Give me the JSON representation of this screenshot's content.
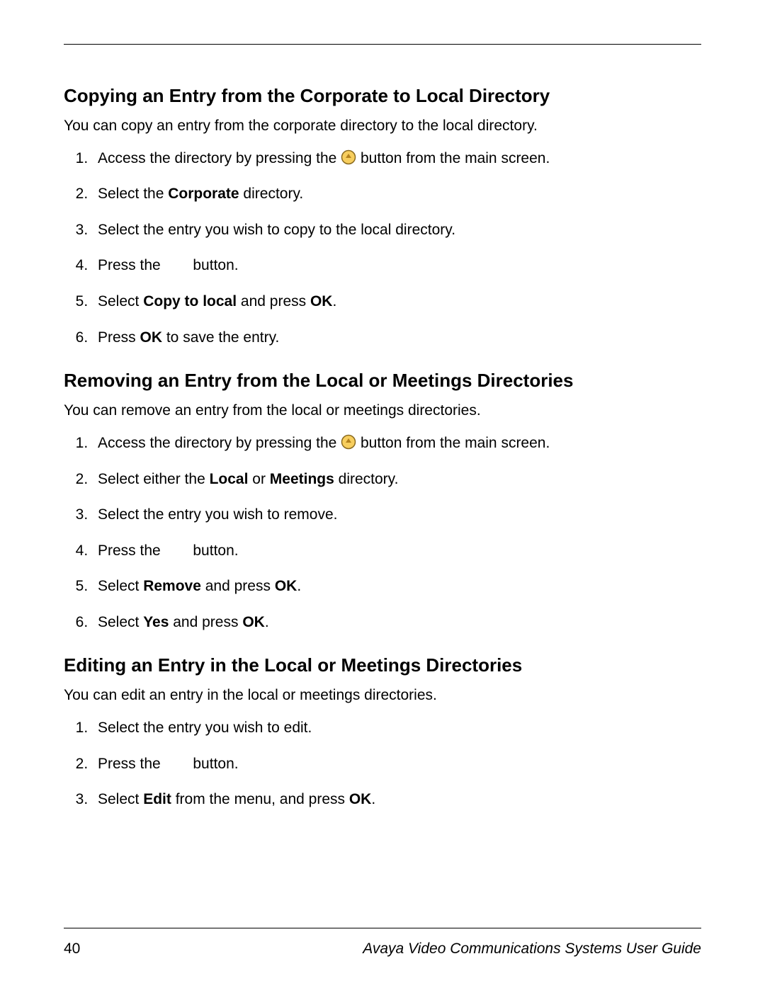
{
  "sections": [
    {
      "heading": "Copying an Entry from the Corporate to Local Directory",
      "intro": "You can copy an entry from the corporate directory to the local directory.",
      "steps": [
        {
          "pre": "Access the directory by pressing the ",
          "icon": "directory-icon",
          "post": " button from the main screen."
        },
        {
          "pre": "Select the ",
          "b1": "Corporate",
          "mid1": " directory."
        },
        {
          "pre": "Select the entry you wish to copy to the local directory."
        },
        {
          "pre": "Press the ",
          "gap": true,
          "mid1": " button."
        },
        {
          "pre": "Select ",
          "b1": "Copy to local",
          "mid1": " and press ",
          "b2": "OK",
          "mid2": "."
        },
        {
          "pre": "Press ",
          "b1": "OK",
          "mid1": " to save the entry."
        }
      ]
    },
    {
      "heading": "Removing an Entry from the Local or Meetings Directories",
      "intro": "You can remove an entry from the local or meetings directories.",
      "steps": [
        {
          "pre": "Access the directory by pressing the ",
          "icon": "directory-icon",
          "post": " button from the main screen."
        },
        {
          "pre": "Select either the ",
          "b1": "Local",
          "mid1": " or ",
          "b2": "Meetings",
          "mid2": " directory."
        },
        {
          "pre": "Select the entry you wish to remove."
        },
        {
          "pre": "Press the ",
          "gap": true,
          "mid1": " button."
        },
        {
          "pre": "Select ",
          "b1": "Remove",
          "mid1": " and press ",
          "b2": "OK",
          "mid2": "."
        },
        {
          "pre": "Select ",
          "b1": "Yes",
          "mid1": " and press ",
          "b2": "OK",
          "mid2": "."
        }
      ]
    },
    {
      "heading": "Editing an Entry in the Local or Meetings Directories",
      "intro": "You can edit an entry in the local or meetings directories.",
      "steps": [
        {
          "pre": "Select the entry you wish to edit."
        },
        {
          "pre": "Press the ",
          "gap": true,
          "mid1": " button."
        },
        {
          "pre": "Select ",
          "b1": "Edit",
          "mid1": " from the menu, and press ",
          "b2": "OK",
          "mid2": "."
        }
      ]
    }
  ],
  "footer": {
    "page_number": "40",
    "publication": "Avaya Video Communications Systems User Guide"
  }
}
